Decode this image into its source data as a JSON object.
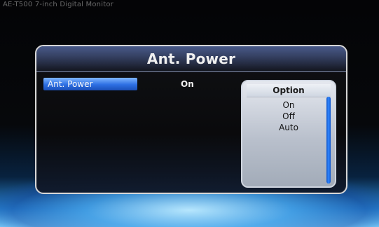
{
  "window": {
    "title": "AE-T500 7-inch Digital Monitor"
  },
  "menu": {
    "title": "Ant. Power",
    "setting": {
      "label": "Ant. Power",
      "value": "On"
    },
    "options": {
      "title": "Option",
      "items": [
        "On",
        "Off",
        "Auto"
      ]
    }
  },
  "colors": {
    "selection_blue": "#2d6fe3",
    "panel_border": "#d7d7d7",
    "option_panel": "#b9c0cc"
  }
}
